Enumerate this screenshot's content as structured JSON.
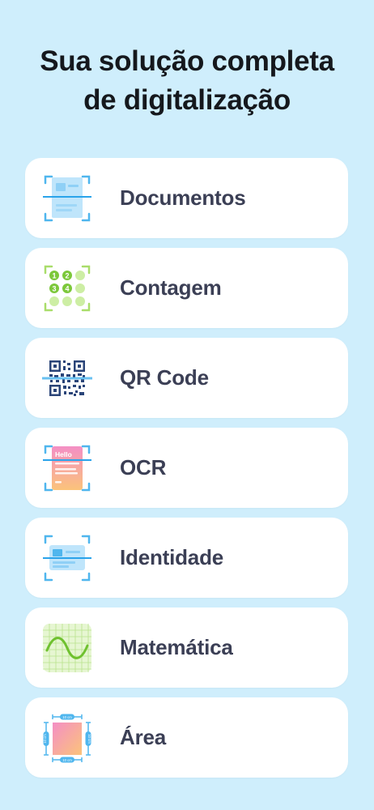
{
  "header": {
    "title_line1": "Sua solução completa",
    "title_line2": "de digitalização"
  },
  "items": [
    {
      "label": "Documentos",
      "icon": "document-scan-icon"
    },
    {
      "label": "Contagem",
      "icon": "counting-dots-icon"
    },
    {
      "label": "QR Code",
      "icon": "qr-code-icon"
    },
    {
      "label": "OCR",
      "icon": "ocr-text-icon"
    },
    {
      "label": "Identidade",
      "icon": "id-card-icon"
    },
    {
      "label": "Matemática",
      "icon": "math-graph-icon"
    },
    {
      "label": "Área",
      "icon": "area-measure-icon"
    }
  ],
  "icon_text": {
    "counting_numbers": [
      "1",
      "2",
      "3",
      "4"
    ],
    "ocr_word": "Hello",
    "area_width": "10 cm",
    "area_height": "10 cm"
  },
  "colors": {
    "background": "#cfeefc",
    "card": "#ffffff",
    "label": "#3b3f55",
    "accent_blue": "#4fb6ee",
    "green": "#a9dd6a",
    "pink": "#f48fc5"
  }
}
